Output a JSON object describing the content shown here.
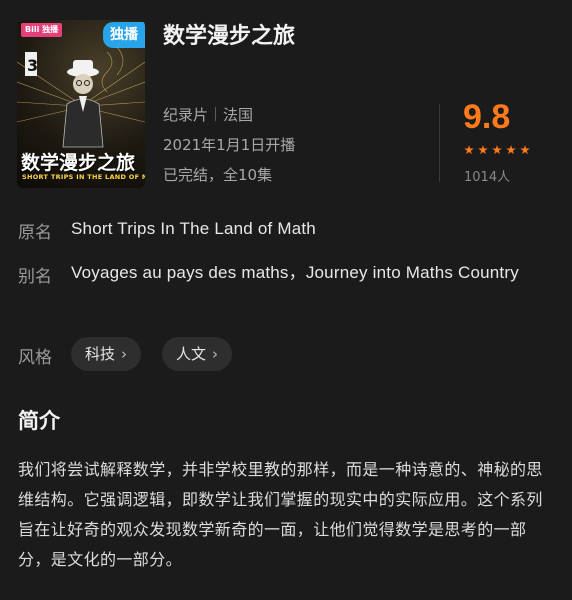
{
  "poster": {
    "logo_tag": "Bili 独播",
    "exclusive_badge": "独播",
    "title": "数学漫步之旅",
    "subtitle": "SHORT TRIPS IN THE LAND OF MATH"
  },
  "header": {
    "title": "数学漫步之旅",
    "category": "纪录片",
    "region": "法国",
    "release": "2021年1月1日开播",
    "status": "已完结，全10集"
  },
  "rating": {
    "score": "9.8",
    "stars": 5,
    "count": "1014人",
    "accent_color": "#ff7a1a"
  },
  "details": {
    "original_label": "原名",
    "original_value": "Short Trips In The Land of Math",
    "alias_label": "别名",
    "alias_value": "Voyages au pays des maths，Journey into Maths Country",
    "genre_label": "风格",
    "genres": [
      "科技",
      "人文"
    ]
  },
  "synopsis": {
    "title": "简介",
    "text": "我们将尝试解释数学，并非学校里教的那样，而是一种诗意的、神秘的思维结构。它强调逻辑，即数学让我们掌握的现实中的实际应用。这个系列旨在让好奇的观众发现数学新奇的一面，让他们觉得数学是思考的一部分，是文化的一部分。"
  }
}
